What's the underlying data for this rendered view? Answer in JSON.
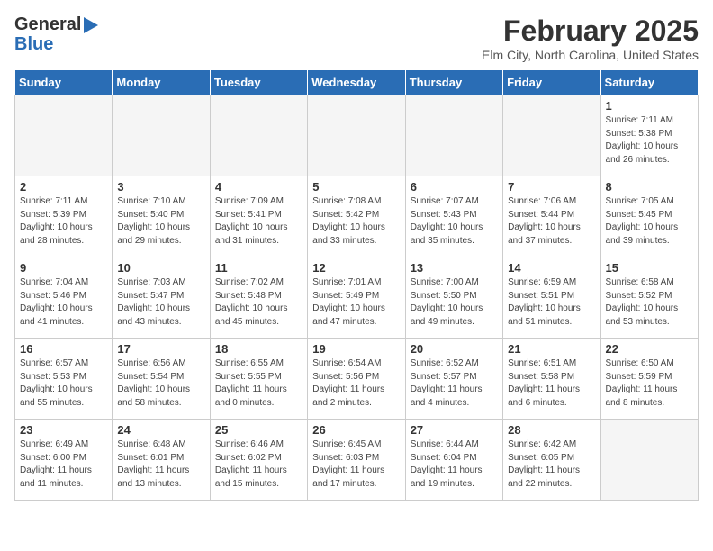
{
  "header": {
    "logo_general": "General",
    "logo_blue": "Blue",
    "title": "February 2025",
    "subtitle": "Elm City, North Carolina, United States"
  },
  "days_of_week": [
    "Sunday",
    "Monday",
    "Tuesday",
    "Wednesday",
    "Thursday",
    "Friday",
    "Saturday"
  ],
  "weeks": [
    [
      {
        "day": "",
        "info": ""
      },
      {
        "day": "",
        "info": ""
      },
      {
        "day": "",
        "info": ""
      },
      {
        "day": "",
        "info": ""
      },
      {
        "day": "",
        "info": ""
      },
      {
        "day": "",
        "info": ""
      },
      {
        "day": "1",
        "info": "Sunrise: 7:11 AM\nSunset: 5:38 PM\nDaylight: 10 hours and 26 minutes."
      }
    ],
    [
      {
        "day": "2",
        "info": "Sunrise: 7:11 AM\nSunset: 5:39 PM\nDaylight: 10 hours and 28 minutes."
      },
      {
        "day": "3",
        "info": "Sunrise: 7:10 AM\nSunset: 5:40 PM\nDaylight: 10 hours and 29 minutes."
      },
      {
        "day": "4",
        "info": "Sunrise: 7:09 AM\nSunset: 5:41 PM\nDaylight: 10 hours and 31 minutes."
      },
      {
        "day": "5",
        "info": "Sunrise: 7:08 AM\nSunset: 5:42 PM\nDaylight: 10 hours and 33 minutes."
      },
      {
        "day": "6",
        "info": "Sunrise: 7:07 AM\nSunset: 5:43 PM\nDaylight: 10 hours and 35 minutes."
      },
      {
        "day": "7",
        "info": "Sunrise: 7:06 AM\nSunset: 5:44 PM\nDaylight: 10 hours and 37 minutes."
      },
      {
        "day": "8",
        "info": "Sunrise: 7:05 AM\nSunset: 5:45 PM\nDaylight: 10 hours and 39 minutes."
      }
    ],
    [
      {
        "day": "9",
        "info": "Sunrise: 7:04 AM\nSunset: 5:46 PM\nDaylight: 10 hours and 41 minutes."
      },
      {
        "day": "10",
        "info": "Sunrise: 7:03 AM\nSunset: 5:47 PM\nDaylight: 10 hours and 43 minutes."
      },
      {
        "day": "11",
        "info": "Sunrise: 7:02 AM\nSunset: 5:48 PM\nDaylight: 10 hours and 45 minutes."
      },
      {
        "day": "12",
        "info": "Sunrise: 7:01 AM\nSunset: 5:49 PM\nDaylight: 10 hours and 47 minutes."
      },
      {
        "day": "13",
        "info": "Sunrise: 7:00 AM\nSunset: 5:50 PM\nDaylight: 10 hours and 49 minutes."
      },
      {
        "day": "14",
        "info": "Sunrise: 6:59 AM\nSunset: 5:51 PM\nDaylight: 10 hours and 51 minutes."
      },
      {
        "day": "15",
        "info": "Sunrise: 6:58 AM\nSunset: 5:52 PM\nDaylight: 10 hours and 53 minutes."
      }
    ],
    [
      {
        "day": "16",
        "info": "Sunrise: 6:57 AM\nSunset: 5:53 PM\nDaylight: 10 hours and 55 minutes."
      },
      {
        "day": "17",
        "info": "Sunrise: 6:56 AM\nSunset: 5:54 PM\nDaylight: 10 hours and 58 minutes."
      },
      {
        "day": "18",
        "info": "Sunrise: 6:55 AM\nSunset: 5:55 PM\nDaylight: 11 hours and 0 minutes."
      },
      {
        "day": "19",
        "info": "Sunrise: 6:54 AM\nSunset: 5:56 PM\nDaylight: 11 hours and 2 minutes."
      },
      {
        "day": "20",
        "info": "Sunrise: 6:52 AM\nSunset: 5:57 PM\nDaylight: 11 hours and 4 minutes."
      },
      {
        "day": "21",
        "info": "Sunrise: 6:51 AM\nSunset: 5:58 PM\nDaylight: 11 hours and 6 minutes."
      },
      {
        "day": "22",
        "info": "Sunrise: 6:50 AM\nSunset: 5:59 PM\nDaylight: 11 hours and 8 minutes."
      }
    ],
    [
      {
        "day": "23",
        "info": "Sunrise: 6:49 AM\nSunset: 6:00 PM\nDaylight: 11 hours and 11 minutes."
      },
      {
        "day": "24",
        "info": "Sunrise: 6:48 AM\nSunset: 6:01 PM\nDaylight: 11 hours and 13 minutes."
      },
      {
        "day": "25",
        "info": "Sunrise: 6:46 AM\nSunset: 6:02 PM\nDaylight: 11 hours and 15 minutes."
      },
      {
        "day": "26",
        "info": "Sunrise: 6:45 AM\nSunset: 6:03 PM\nDaylight: 11 hours and 17 minutes."
      },
      {
        "day": "27",
        "info": "Sunrise: 6:44 AM\nSunset: 6:04 PM\nDaylight: 11 hours and 19 minutes."
      },
      {
        "day": "28",
        "info": "Sunrise: 6:42 AM\nSunset: 6:05 PM\nDaylight: 11 hours and 22 minutes."
      },
      {
        "day": "",
        "info": ""
      }
    ]
  ]
}
